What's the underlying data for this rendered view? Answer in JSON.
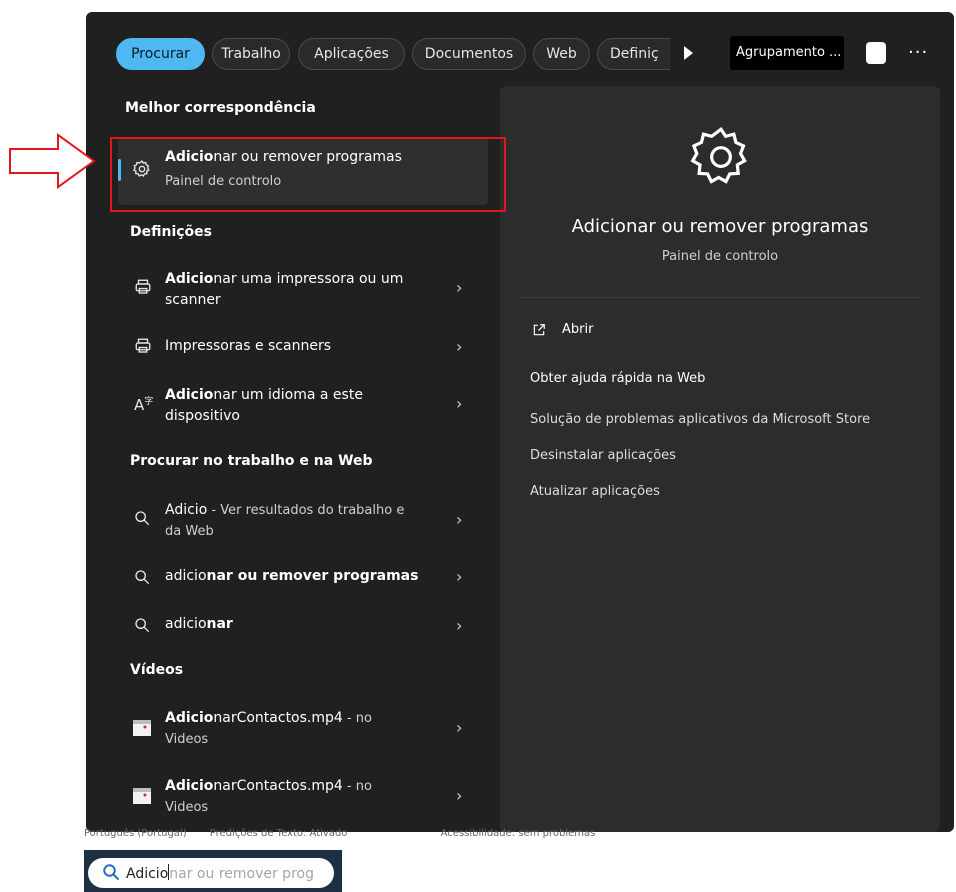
{
  "filters": [
    {
      "label": "Procurar",
      "active": true
    },
    {
      "label": "Trabalho"
    },
    {
      "label": "Aplicações"
    },
    {
      "label": "Documentos"
    },
    {
      "label": "Web"
    },
    {
      "label": "Definiç"
    }
  ],
  "group_button": "Agrupamento ...",
  "more_label": "···",
  "sections": {
    "best": "Melhor correspondência",
    "settings": "Definições",
    "web": "Procurar no trabalho e na Web",
    "videos": "Vídeos"
  },
  "best_match": {
    "bold": "Adicio",
    "rest": "nar ou remover programas",
    "sub": "Painel de controlo"
  },
  "settings_items": [
    {
      "bold": "Adicio",
      "rest": "nar uma impressora ou um",
      "line2": "scanner",
      "icon": "printer-icon"
    },
    {
      "bold": "",
      "rest": "Impressoras e scanners",
      "icon": "printer-icon"
    },
    {
      "bold": "Adicio",
      "rest": "nar um idioma a este",
      "line2": "dispositivo",
      "icon": "language-icon"
    }
  ],
  "web_items": [
    {
      "main": "Adicio",
      "suffix": " - Ver resultados do trabalho e",
      "line2": "da Web"
    },
    {
      "main": "adicio",
      "bold": "nar ou remover programas"
    },
    {
      "main": "adicio",
      "bold": "nar"
    }
  ],
  "video_items": [
    {
      "bold": "Adicio",
      "rest": "narContactos.mp4",
      "suffix": " - no",
      "line2": "Videos"
    },
    {
      "bold": "Adicio",
      "rest": "narContactos.mp4",
      "suffix": " - no",
      "line2": "Videos"
    }
  ],
  "details": {
    "title": "Adicionar ou remover programas",
    "subtitle": "Painel de controlo",
    "actions": [
      "Abrir",
      "Obter ajuda rápida na Web",
      "Solução de problemas aplicativos da Microsoft Store",
      "Desinstalar aplicações",
      "Atualizar aplicações"
    ]
  },
  "status_bar": {
    "language": "Português (Portugal)",
    "predictions": "Predições de Texto: Ativado",
    "accessibility": "Acessibilidade: sem problemas"
  },
  "search": {
    "typed": "Adicio",
    "suggestion": "nar ou remover prog"
  },
  "colors": {
    "accent": "#4fb8f2",
    "highlight": "#e4151d",
    "panel": "#202020"
  }
}
